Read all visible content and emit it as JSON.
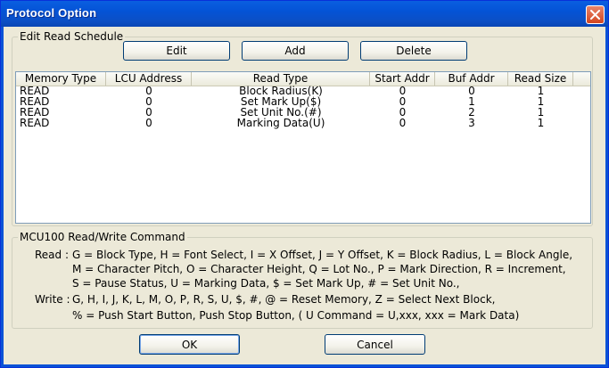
{
  "window": {
    "title": "Protocol Option"
  },
  "schedule": {
    "group_label": "Edit Read Schedule",
    "buttons": {
      "edit": "Edit",
      "add": "Add",
      "delete": "Delete"
    },
    "columns": [
      "Memory Type",
      "LCU Address",
      "Read Type",
      "Start Addr",
      "Buf Addr",
      "Read Size"
    ],
    "rows": [
      [
        "READ",
        "0",
        "Block Radius(K)",
        "0",
        "0",
        "1"
      ],
      [
        "READ",
        "0",
        "Set Mark Up($)",
        "0",
        "1",
        "1"
      ],
      [
        "READ",
        "0",
        "Set Unit No.(#)",
        "0",
        "2",
        "1"
      ],
      [
        "READ",
        "0",
        "Marking Data(U)",
        "0",
        "3",
        "1"
      ]
    ]
  },
  "commands": {
    "group_label": "MCU100 Read/Write Command",
    "read_label": "Read :",
    "read_lines": [
      "G = Block Type,  H = Font Select,  I = X Offset,  J = Y Offset,  K = Block Radius,  L = Block Angle,",
      "M = Character Pitch,  O = Character Height,  Q = Lot No.,  P = Mark Direction,  R = Increment,",
      "S = Pause Status,  U = Marking Data,  $ = Set Mark Up,  # = Set Unit No.,"
    ],
    "write_label": "Write :",
    "write_lines": [
      "G,  H,  I,  J,  K,  L,  M,  O,  P,  R,  S,  U,  $,  #,  @ = Reset Memory,  Z = Select Next Block,",
      "% = Push Start Button,  Push Stop Button,            ( U Command = U,xxx,    xxx = Mark Data)"
    ]
  },
  "footer": {
    "ok": "OK",
    "cancel": "Cancel"
  }
}
